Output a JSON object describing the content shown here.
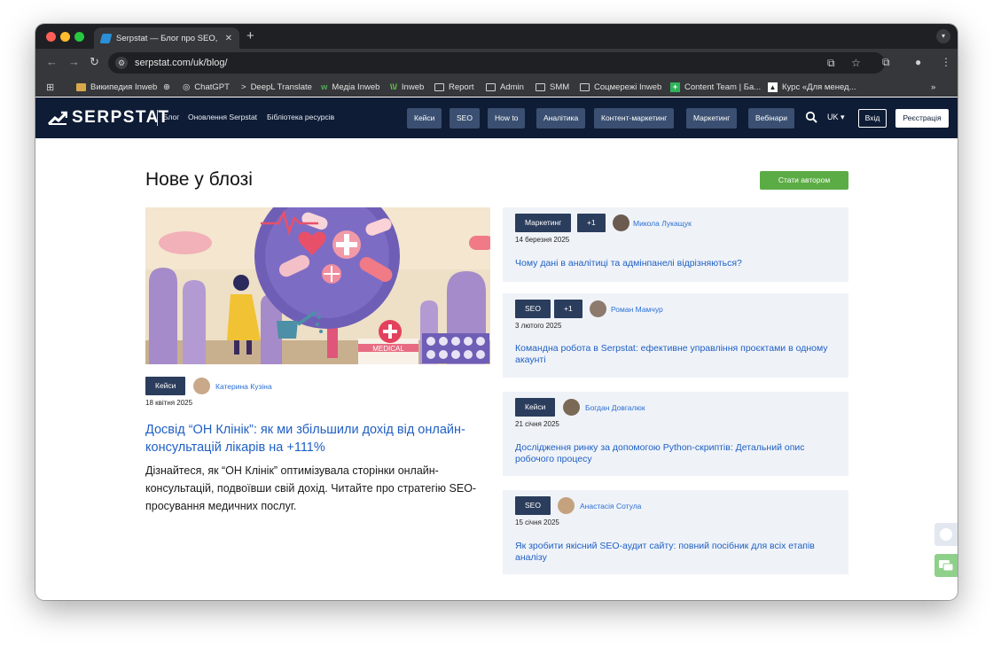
{
  "browser": {
    "tab_title": "Serpstat — Блог про SEO, PP",
    "tab_close": "✕",
    "new_tab": "+",
    "url": "serpstat.com/uk/blog/",
    "bookmarks": [
      "Википедия Inweb",
      "ChatGPT",
      "DeepL Translate",
      "Медіа Inweb",
      "Inweb",
      "Report",
      "Admin",
      "SMM",
      "Соцмережі Inweb",
      "Content Team | Ба...",
      "Курс «Для менед..."
    ],
    "more": "»",
    "colors": {
      "chrome_dark": "#1f2023",
      "chrome_mid": "#36373a"
    }
  },
  "site": {
    "logo": "SERPSTAT",
    "header_links": [
      "Блог",
      "Оновлення Serpstat",
      "Бібліотека ресурсів"
    ],
    "categories": [
      "Кейси",
      "SEO",
      "How to",
      "Аналітика",
      "Контент-маркетинг",
      "Маркетинг",
      "Вебінари"
    ],
    "lang": "UK ▾",
    "login": "Вхід",
    "register": "Реєстрація",
    "colors": {
      "header_bg": "#0e1c35",
      "category_bg": "#3a4f71",
      "accent_green": "#5cac45",
      "link_blue": "#1f5fc4"
    }
  },
  "main": {
    "title": "Нове у блозі",
    "become_author": "Стати автором",
    "featured": {
      "tag": "Кейси",
      "author": "Катерина Кузіна",
      "date": "18 квітня 2025",
      "title": "Досвід “ОН Клінік”: як ми збільшили дохід від онлайн-консультацій лікарів на +111%",
      "description": "Дізнайтеся, як “ОН Клінік” оптимізувала сторінки онлайн-консультацій, подвоївши свій дохід. Читайте про стратегію SEO-просування медичних послуг.",
      "image_label": "MEDICAL"
    },
    "posts": [
      {
        "tag": "Маркетинг",
        "extra": "+1",
        "author": "Микола Лукащук",
        "date": "14 березня 2025",
        "title": "Чому дані в аналітиці та адмінпанелі відрізняються?"
      },
      {
        "tag": "SEO",
        "extra": "+1",
        "author": "Роман Мамчур",
        "date": "3 лютого 2025",
        "title": "Командна робота в Serpstat: ефективне управління проєктами в одному акаунті"
      },
      {
        "tag": "Кейси",
        "extra": "",
        "author": "Богдан Довгалюк",
        "date": "21 січня 2025",
        "title": "Дослідження ринку за допомогою Python-скриптів: Детальний опис робочого процесу"
      },
      {
        "tag": "SEO",
        "extra": "",
        "author": "Анастасія Сотула",
        "date": "15 січня 2025",
        "title": "Як зробити якісний SEO-аудит сайту: повний посібник для всіх етапів аналізу"
      }
    ]
  }
}
